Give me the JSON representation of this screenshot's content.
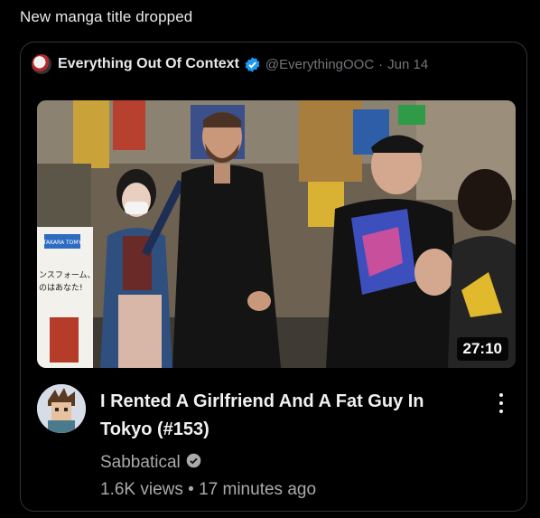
{
  "tweet": {
    "text": "New manga title dropped"
  },
  "quote": {
    "display_name": "Everything Out Of Context",
    "handle": "@EverythingOOC",
    "separator": "·",
    "date": "Jun 14"
  },
  "video": {
    "duration": "27:10",
    "title": "I Rented A Girlfriend And A Fat Guy In Tokyo (#153)",
    "channel": "Sabbatical",
    "views": "1.6K views",
    "stats_separator": "•",
    "age": "17 minutes ago"
  },
  "store_sign": {
    "brand": "TAKARA TOMY",
    "text_line1": "ンスフォーム、",
    "text_line2": "のはあなた!"
  },
  "colors": {
    "verified_blue": "#1d9bf0",
    "muted": "#71767b",
    "yt_secondary": "#aaaaaa",
    "card_border": "#2f3336"
  },
  "icons": [
    "verified-badge-icon",
    "channel-verified-icon",
    "more-vertical-icon"
  ]
}
